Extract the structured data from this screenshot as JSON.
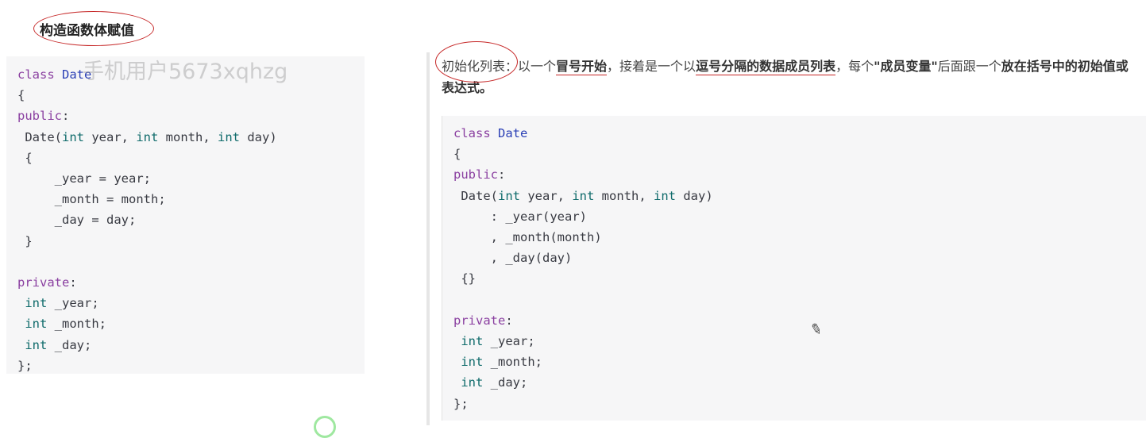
{
  "heading": "构造函数体赋值",
  "watermark": "手机用户5673xqhzg",
  "description": {
    "lead": "初始化列表",
    "part1": "：以一个",
    "bold1": "冒号开始",
    "part2": "，接着是一个以",
    "bold2": "逗号分隔的数据成员列表",
    "part3": "，每个",
    "bold3": "\"成员变量\"",
    "part4": "后面跟一个",
    "bold4": "放在括号中的初始值或表达式。"
  },
  "code_left": {
    "l1_kw": "class",
    "l1_name": "Date",
    "l2": "{",
    "l3_kw": "public",
    "l4_fn": "Date(",
    "l4_t1": "int",
    "l4_a1": " year, ",
    "l4_t2": "int",
    "l4_a2": " month, ",
    "l4_t3": "int",
    "l4_a3": " day)",
    "l5": "{",
    "l6": "_year = year;",
    "l7": "_month = month;",
    "l8": "_day = day;",
    "l9": "}",
    "l11_kw": "private",
    "l12_t": "int",
    "l12_v": " _year;",
    "l13_t": "int",
    "l13_v": " _month;",
    "l14_t": "int",
    "l14_v": " _day;",
    "l15": "};"
  },
  "code_right": {
    "l1_kw": "class",
    "l1_name": "Date",
    "l2": "{",
    "l3_kw": "public",
    "l4_fn": "Date(",
    "l4_t1": "int",
    "l4_a1": " year, ",
    "l4_t2": "int",
    "l4_a2": " month, ",
    "l4_t3": "int",
    "l4_a3": " day)",
    "l5": ": _year(year)",
    "l6": ", _month(month)",
    "l7": ", _day(day)",
    "l8": "{}",
    "l10_kw": "private",
    "l11_t": "int",
    "l11_v": " _year;",
    "l12_t": "int",
    "l12_v": " _month;",
    "l13_t": "int",
    "l13_v": " _day;",
    "l14": "};"
  },
  "icons": {
    "pencil": "pencil-icon"
  }
}
